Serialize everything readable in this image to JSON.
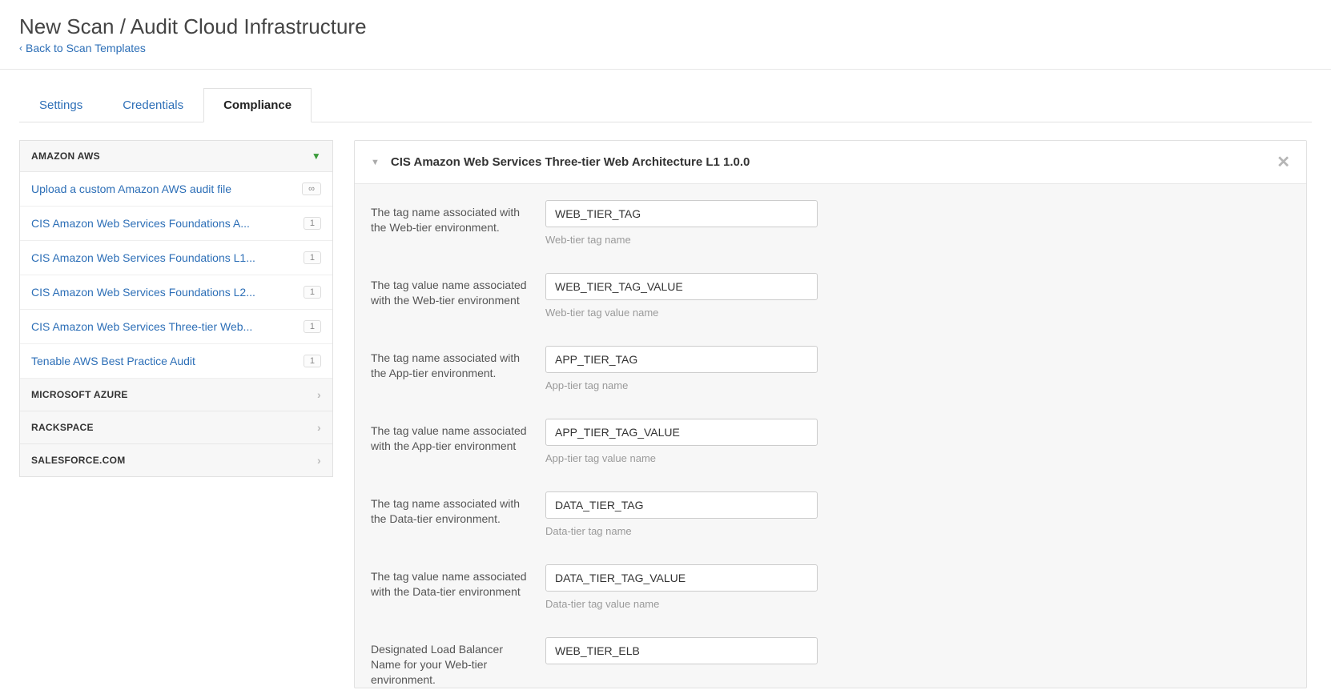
{
  "header": {
    "title": "New Scan / Audit Cloud Infrastructure",
    "back_label": "Back to Scan Templates"
  },
  "tabs": {
    "settings": "Settings",
    "credentials": "Credentials",
    "compliance": "Compliance"
  },
  "sidebar": {
    "categories": [
      {
        "name": "AMAZON AWS",
        "expanded": true
      },
      {
        "name": "MICROSOFT AZURE",
        "expanded": false
      },
      {
        "name": "RACKSPACE",
        "expanded": false
      },
      {
        "name": "SALESFORCE.COM",
        "expanded": false
      }
    ],
    "aws_items": [
      {
        "label": "Upload a custom Amazon AWS audit file",
        "badge": "∞"
      },
      {
        "label": "CIS Amazon Web Services Foundations A...",
        "badge": "1"
      },
      {
        "label": "CIS Amazon Web Services Foundations L1...",
        "badge": "1"
      },
      {
        "label": "CIS Amazon Web Services Foundations L2...",
        "badge": "1"
      },
      {
        "label": "CIS Amazon Web Services Three-tier Web...",
        "badge": "1"
      },
      {
        "label": "Tenable AWS Best Practice Audit",
        "badge": "1"
      }
    ]
  },
  "panel": {
    "title": "CIS Amazon Web Services Three-tier Web Architecture L1 1.0.0",
    "fields": [
      {
        "label": "The tag name associated with the Web-tier environment.",
        "value": "WEB_TIER_TAG",
        "helper": "Web-tier tag name"
      },
      {
        "label": "The tag value name associated with the Web-tier environment",
        "value": "WEB_TIER_TAG_VALUE",
        "helper": "Web-tier tag value name"
      },
      {
        "label": "The tag name associated with the App-tier environment.",
        "value": "APP_TIER_TAG",
        "helper": "App-tier tag name"
      },
      {
        "label": "The tag value name associated with the App-tier environment",
        "value": "APP_TIER_TAG_VALUE",
        "helper": "App-tier tag value name"
      },
      {
        "label": "The tag name associated with the Data-tier environment.",
        "value": "DATA_TIER_TAG",
        "helper": "Data-tier tag name"
      },
      {
        "label": "The tag value name associated with the Data-tier environment",
        "value": "DATA_TIER_TAG_VALUE",
        "helper": "Data-tier tag value name"
      },
      {
        "label": "Designated Load Balancer Name for your Web-tier environment.",
        "value": "WEB_TIER_ELB",
        "helper": ""
      }
    ]
  }
}
